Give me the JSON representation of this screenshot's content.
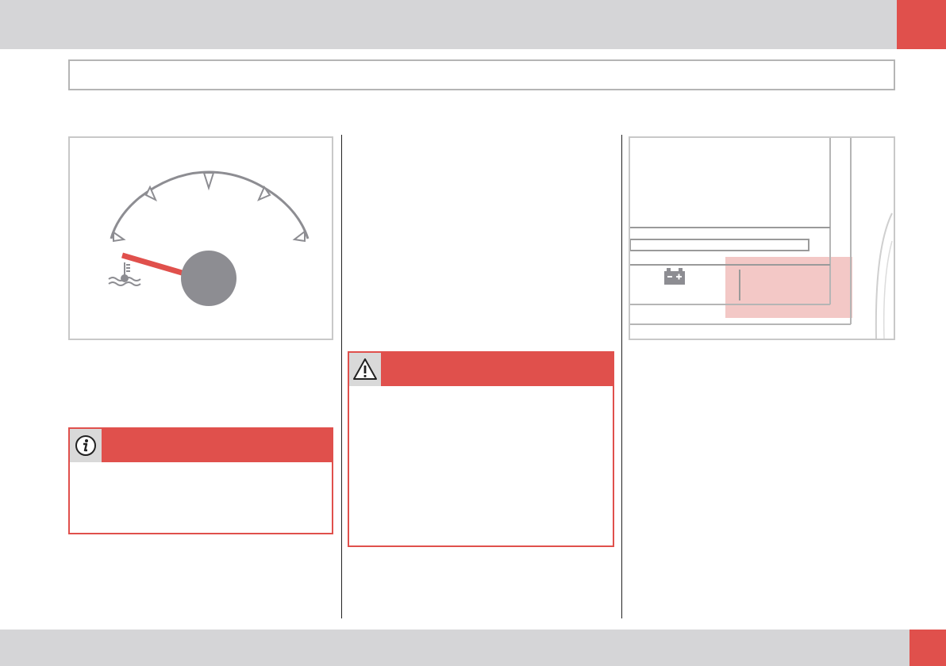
{
  "colors": {
    "accent": "#e0504c",
    "bar_gray": "#d5d5d7",
    "gauge_gray": "#8d8d92",
    "frame_gray": "#c8c8c8",
    "highlight_pink": "#f3c8c6"
  },
  "icons": {
    "gauge_symbol": "coolant-temperature-icon",
    "panel_symbol": "battery-icon",
    "note_symbol": "info-icon",
    "warning_symbol": "warning-triangle-icon"
  },
  "gauge": {
    "needle_level": 0.08
  }
}
